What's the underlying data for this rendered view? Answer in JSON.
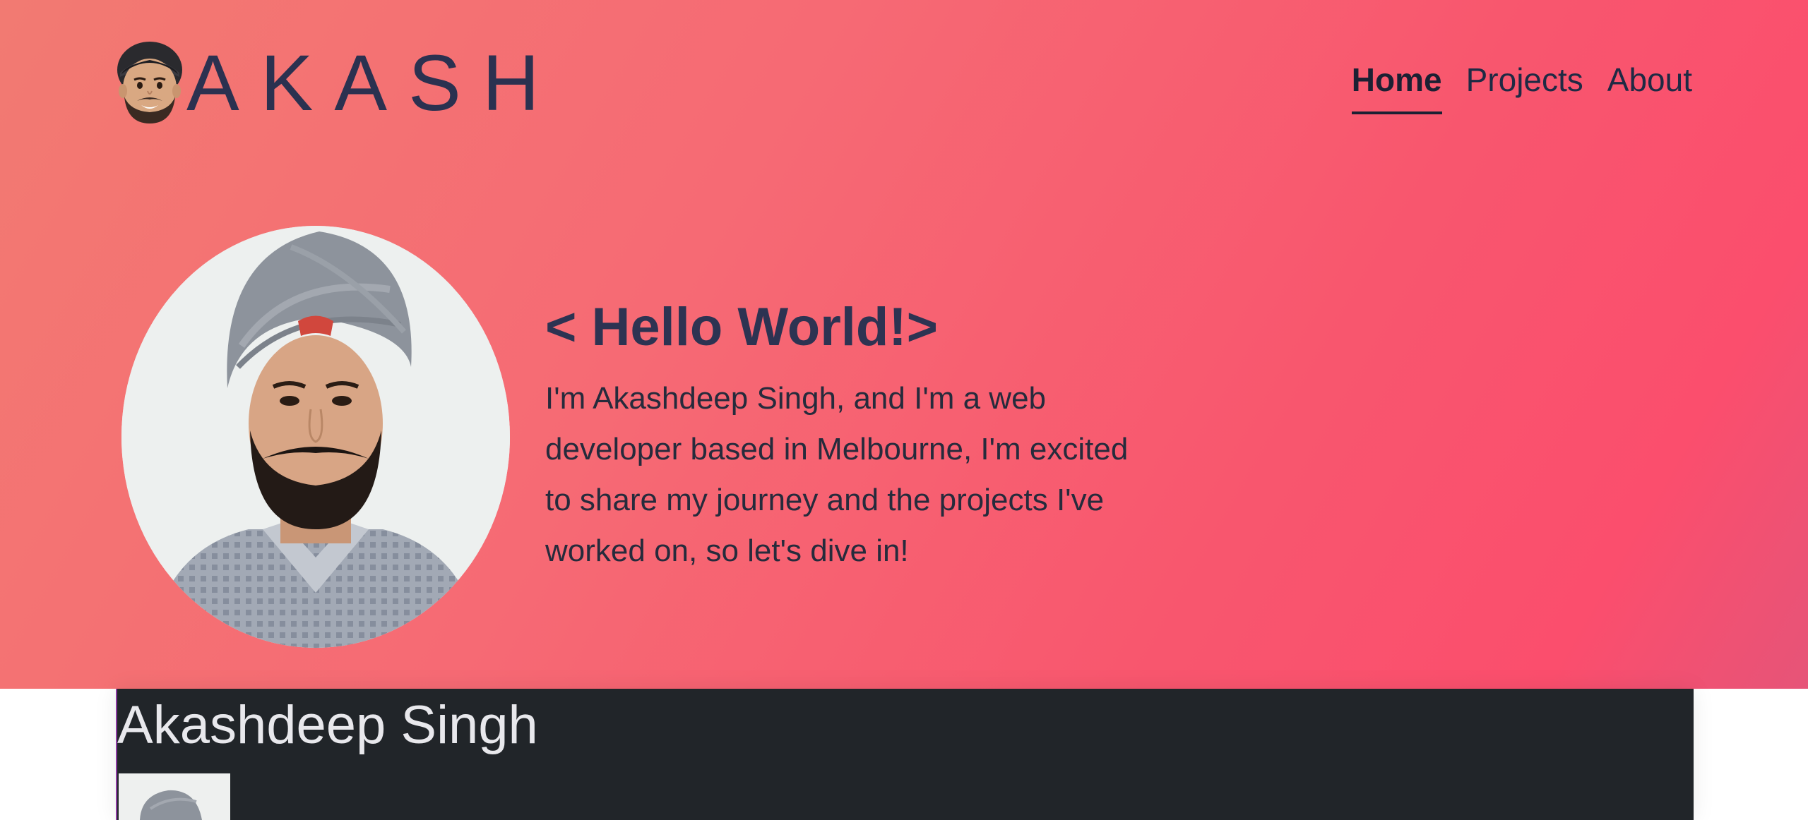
{
  "header": {
    "brand_text": "AKASH",
    "logo_icon": "memoji-avatar-icon",
    "nav": [
      {
        "label": "Home",
        "active": true
      },
      {
        "label": "Projects",
        "active": false
      },
      {
        "label": "About",
        "active": false
      }
    ]
  },
  "hero": {
    "photo_icon": "profile-photo",
    "heading": "< Hello World!>",
    "lines": [
      "I'm Akashdeep Singh, and I'm a web",
      "developer based in Melbourne, I'm excited",
      "to share my journey and the projects I've",
      "worked on, so let's dive in!"
    ]
  },
  "section": {
    "title": "Akashdeep Singh",
    "thumbnail_icon": "profile-thumbnail"
  },
  "colors": {
    "gradient_start": "#f27a72",
    "gradient_end": "#fb4e6d",
    "text_dark": "#2d3352",
    "panel_bg": "#212529"
  }
}
